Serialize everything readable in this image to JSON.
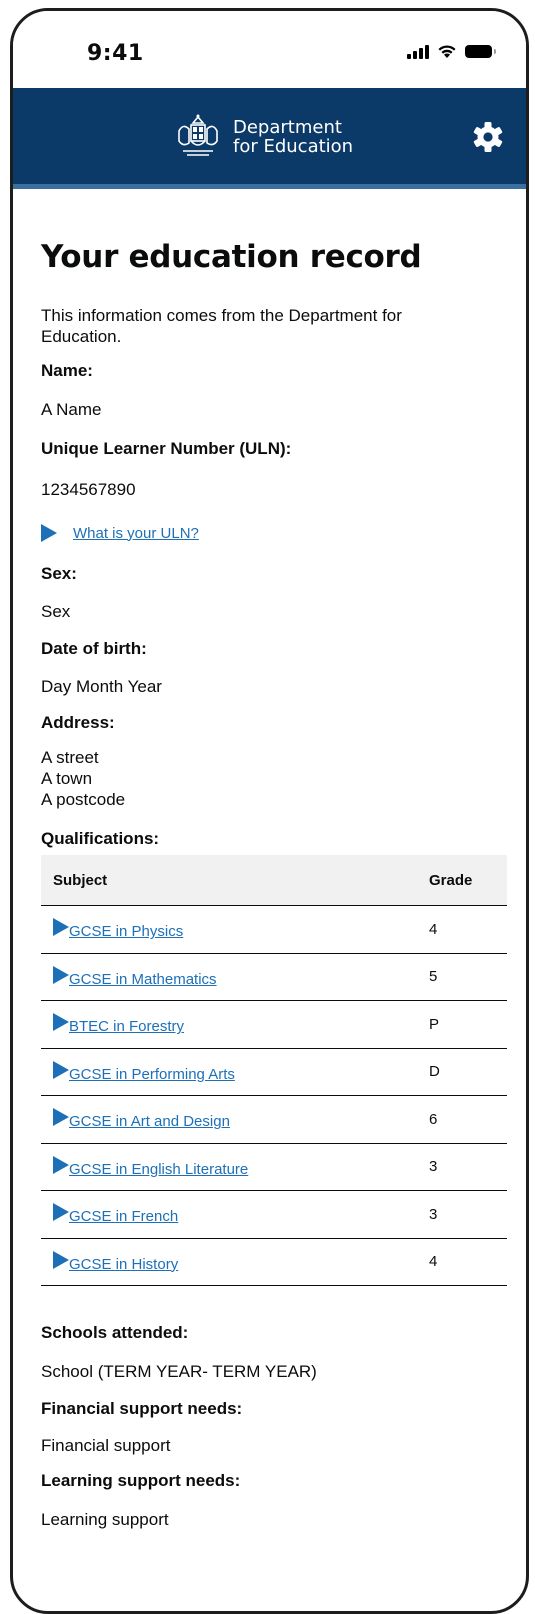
{
  "status_bar": {
    "time": "9:41"
  },
  "header": {
    "brand_line1": "Department",
    "brand_line2": "for Education"
  },
  "page": {
    "title": "Your education record",
    "intro": "This information comes from the Department for Education.",
    "name_label": "Name:",
    "name_value": "A Name",
    "uln_label": "Unique Learner Number (ULN):",
    "uln_value": "1234567890",
    "uln_help_link": "What is your ULN?",
    "sex_label": "Sex:",
    "sex_value": "Sex",
    "dob_label": "Date of birth:",
    "dob_value": "Day Month Year",
    "address_label": "Address:",
    "address_line1": "A street",
    "address_line2": "A town",
    "address_line3": "A postcode",
    "qualifications_label": "Qualifications:",
    "schools_label": "Schools attended:",
    "schools_value": "School (TERM YEAR- TERM YEAR)",
    "financial_label": "Financial support needs:",
    "financial_value": "Financial support",
    "learning_label": "Learning support needs:",
    "learning_value": "Learning support"
  },
  "qualifications": {
    "headers": {
      "subject": "Subject",
      "grade": "Grade"
    },
    "rows": [
      {
        "subject": "GCSE in Physics",
        "grade": "4"
      },
      {
        "subject": "GCSE in Mathematics",
        "grade": "5"
      },
      {
        "subject": "BTEC in Forestry",
        "grade": "P"
      },
      {
        "subject": "GCSE in Performing Arts",
        "grade": "D"
      },
      {
        "subject": "GCSE in Art and Design",
        "grade": "6"
      },
      {
        "subject": "GCSE in English Literature",
        "grade": "3"
      },
      {
        "subject": "GCSE in French",
        "grade": "3"
      },
      {
        "subject": "GCSE in History",
        "grade": "4"
      }
    ]
  },
  "colors": {
    "header_bg": "#0b3a68",
    "link": "#1d70b8",
    "table_header_bg": "#f1f1f1"
  },
  "icons": {
    "settings": "gear-icon",
    "crest": "royal-crest-icon",
    "expand": "triangle-right-icon"
  }
}
